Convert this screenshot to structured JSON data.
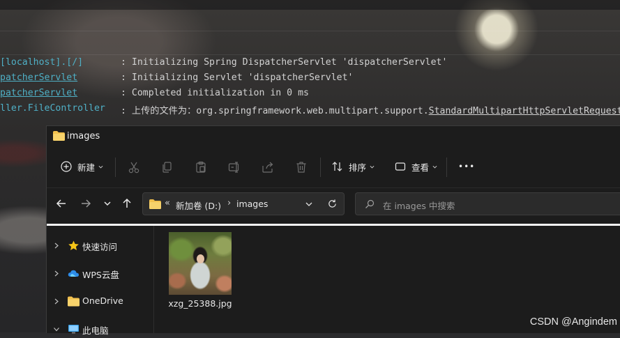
{
  "console": {
    "lines": [
      {
        "source": "[localhost].[/]",
        "message": ": Initializing Spring DispatcherServlet 'dispatcherServlet'"
      },
      {
        "source": "patcherServlet",
        "message": ": Initializing Servlet 'dispatcherServlet'"
      },
      {
        "source": "patcherServlet",
        "message": ": Completed initialization in 0 ms"
      },
      {
        "source": "ller.FileController",
        "message_prefix": ": 上传的文件为：org.springframework.web.multipart.support.",
        "message_link": "StandardMultipartHttpServletRequest"
      }
    ]
  },
  "explorer": {
    "title": "images",
    "toolbar": {
      "new_label": "新建",
      "sort_label": "排序",
      "view_label": "查看",
      "more_label": "•••"
    },
    "address": {
      "back_quote": "«",
      "drive": "新加卷 (D:)",
      "separator": "›",
      "folder": "images"
    },
    "search": {
      "placeholder": "在 images 中搜索"
    },
    "nav": [
      {
        "label": "快速访问",
        "icon": "star-icon",
        "expanded": false
      },
      {
        "label": "WPS云盘",
        "icon": "cloud-icon",
        "expanded": false
      },
      {
        "label": "OneDrive",
        "icon": "folder-icon",
        "expanded": false
      },
      {
        "label": "此电脑",
        "icon": "computer-icon",
        "expanded": true
      }
    ],
    "files": [
      {
        "name": "xzg_25388.jpg"
      }
    ]
  },
  "watermark": "CSDN @Angindem",
  "colors": {
    "console_source": "#4fb0c6",
    "folder": "#f2c14e",
    "star": "#f5c518",
    "window_bg": "#1c1c1c"
  }
}
